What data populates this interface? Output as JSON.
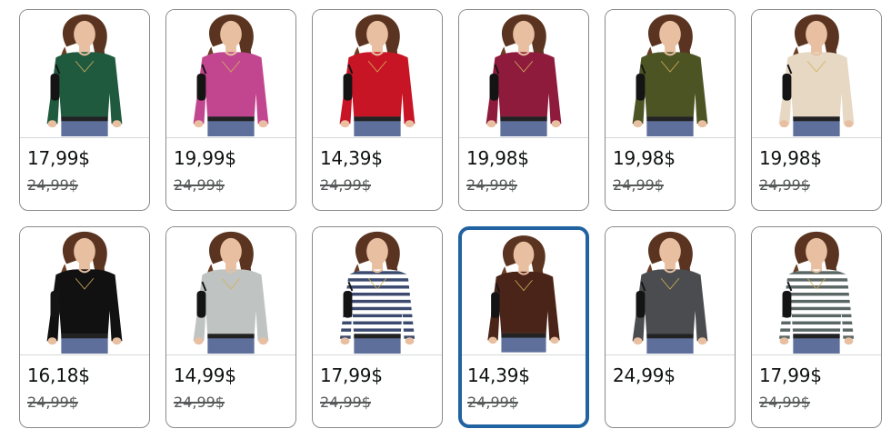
{
  "swatches": [
    {
      "price": "17,99$",
      "list_price": "24,99$",
      "color": "#1f5a3e",
      "pattern": "solid"
    },
    {
      "price": "19,99$",
      "list_price": "24,99$",
      "color": "#c2458f",
      "pattern": "solid"
    },
    {
      "price": "14,39$",
      "list_price": "24,99$",
      "color": "#c81526",
      "pattern": "solid"
    },
    {
      "price": "19,98$",
      "list_price": "24,99$",
      "color": "#8e1a3c",
      "pattern": "solid"
    },
    {
      "price": "19,98$",
      "list_price": "24,99$",
      "color": "#4c5424",
      "pattern": "solid"
    },
    {
      "price": "19,98$",
      "list_price": "24,99$",
      "color": "#e7d8c4",
      "pattern": "solid"
    },
    {
      "price": "16,18$",
      "list_price": "24,99$",
      "color": "#111111",
      "pattern": "solid"
    },
    {
      "price": "14,99$",
      "list_price": "24,99$",
      "color": "#bfc3c2",
      "pattern": "solid"
    },
    {
      "price": "17,99$",
      "list_price": "24,99$",
      "color": "#3b4a6e",
      "pattern": "stripes",
      "stripe_color": "#ffffff"
    },
    {
      "price": "14,39$",
      "list_price": "24,99$",
      "color": "#4a2418",
      "pattern": "solid",
      "selected": true
    },
    {
      "price": "24,99$",
      "list_price": "",
      "color": "#4a4c4f",
      "pattern": "solid"
    },
    {
      "price": "17,99$",
      "list_price": "24,99$",
      "color": "#5b6765",
      "pattern": "stripes",
      "stripe_color": "#ffffff"
    }
  ],
  "colors": {
    "selected_border": "#2162a1",
    "border": "#8a8a8a",
    "price_text": "#0f1111",
    "list_price_text": "#565959"
  }
}
